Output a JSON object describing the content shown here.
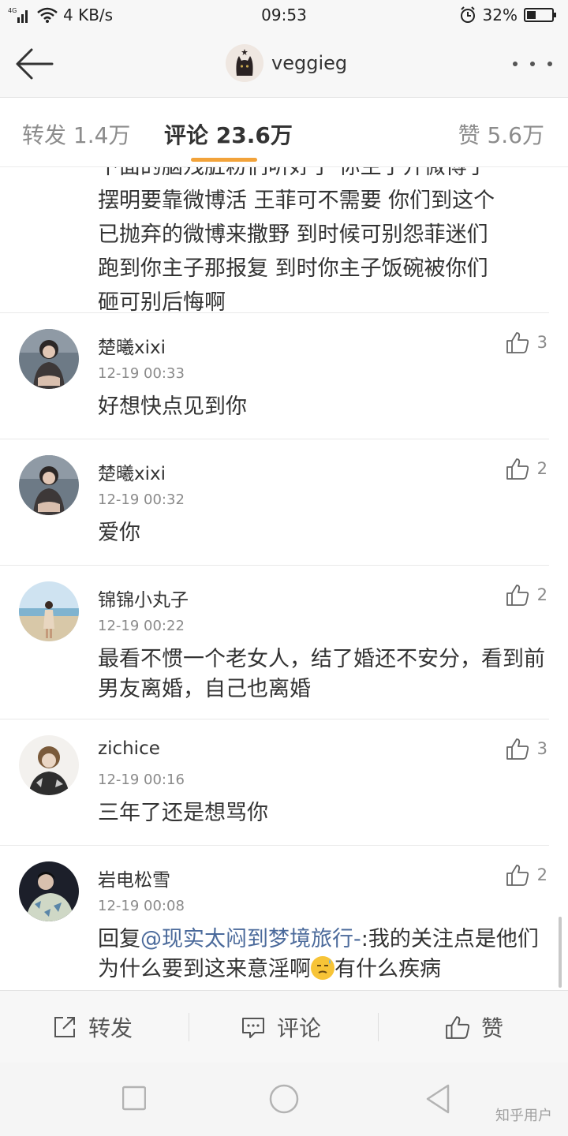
{
  "status_bar": {
    "network": "4G",
    "speed": "4 KB/s",
    "time": "09:53",
    "battery": "32%"
  },
  "header": {
    "title": "veggieg",
    "back_icon": "arrow-left-icon",
    "more_icon": "more-dots-icon"
  },
  "tabs": [
    {
      "label": "转发 1.4万",
      "active": false
    },
    {
      "label": "评论 23.6万",
      "active": true
    },
    {
      "label": "赞 5.6万",
      "active": false
    }
  ],
  "partial_comment": {
    "lines": [
      "下面的脑残脏粉们听好了 你主子开微博了",
      "摆明要靠微博活 王菲可不需要 你们到这个",
      "已抛弃的微博来撒野 到时候可别怨菲迷们",
      "跑到你主子那报复 到时你主子饭碗被你们",
      "砸可别后悔啊"
    ]
  },
  "comments": [
    {
      "user": "楚曦xixi",
      "time": "12-19 00:33",
      "likes": "3",
      "text": "好想快点见到你"
    },
    {
      "user": "楚曦xixi",
      "time": "12-19 00:32",
      "likes": "2",
      "text": "爱你"
    },
    {
      "user": "锦锦小丸子",
      "time": "12-19 00:22",
      "likes": "2",
      "text": "最看不惯一个老女人，结了婚还不安分，看到前男友离婚，自己也离婚"
    },
    {
      "user": "zichice",
      "time": "12-19 00:16",
      "likes": "3",
      "text": "三年了还是想骂你"
    },
    {
      "user": "岩电松雪",
      "time": "12-19 00:08",
      "likes": "2",
      "reply_prefix": "回复",
      "mention": "@现实太闷到梦境旅行-",
      "text_before_emoji": ":我的关注点是他们为什么要到这来意淫啊",
      "text_after_emoji": "有什么疾病"
    }
  ],
  "action_bar": {
    "repost": "转发",
    "comment": "评论",
    "like": "赞"
  },
  "watermark": "知乎用户",
  "colors": {
    "accent": "#f2a33a",
    "link": "#4b6a9b"
  }
}
